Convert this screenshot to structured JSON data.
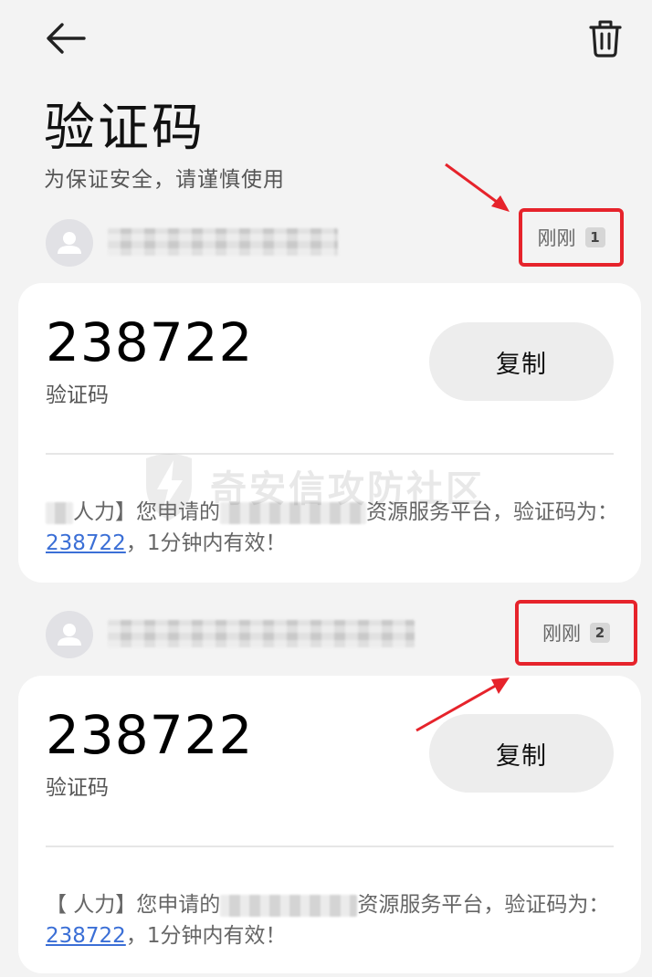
{
  "header": {
    "title": "验证码",
    "subtitle": "为保证安全，请谨慎使用"
  },
  "watermark": {
    "text": "奇安信攻防社区"
  },
  "messages": [
    {
      "time": "刚刚",
      "count": "1",
      "code": "238722",
      "code_label": "验证码",
      "copy_label": "复制",
      "body_part1": "人力】您申请的",
      "body_part2": "资源服务平台，验证码为：",
      "body_code": "238722",
      "body_part3": "，1分钟内有效！"
    },
    {
      "time": "刚刚",
      "count": "2",
      "code": "238722",
      "code_label": "验证码",
      "copy_label": "复制",
      "body_part1": "【     人力】您申请的",
      "body_part2": "资源服务平台，验证码为：",
      "body_code": "238722",
      "body_part3": "，1分钟内有效！"
    }
  ],
  "icons": {
    "back": "back-arrow-icon",
    "trash": "trash-icon",
    "avatar": "person-icon"
  },
  "colors": {
    "annotation_red": "#e6232b",
    "link_blue": "#3b6fd6"
  }
}
